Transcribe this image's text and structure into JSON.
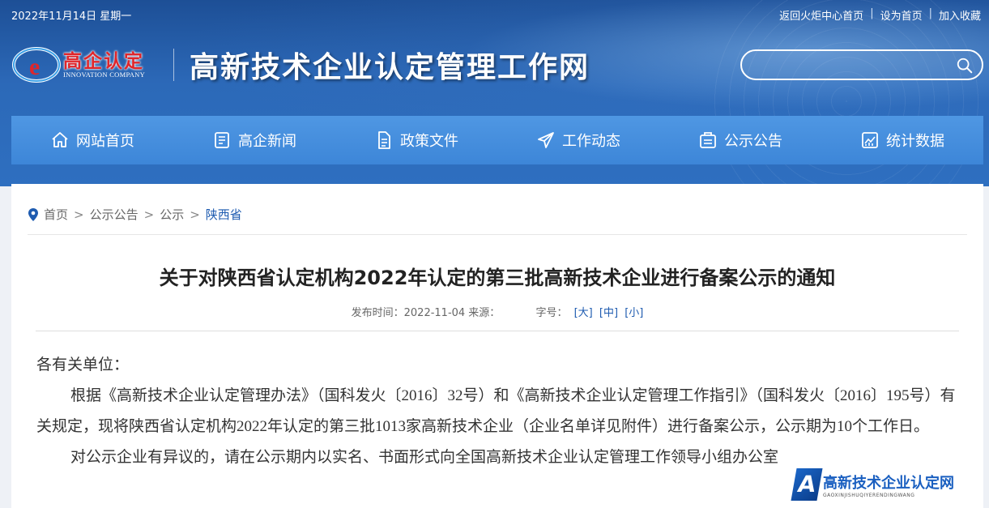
{
  "topbar": {
    "date": "2022年11月14日 星期一",
    "links": [
      "返回火炬中心首页",
      "设为首页",
      "加入收藏"
    ]
  },
  "logo": {
    "name": "高企认定",
    "en": "INNOVATION COMPANY"
  },
  "site_title": "高新技术企业认定管理工作网",
  "search": {
    "placeholder": "",
    "icon": "search-icon"
  },
  "nav": [
    {
      "label": "网站首页",
      "icon": "home-icon"
    },
    {
      "label": "高企新闻",
      "icon": "news-icon"
    },
    {
      "label": "政策文件",
      "icon": "document-icon"
    },
    {
      "label": "工作动态",
      "icon": "send-icon"
    },
    {
      "label": "公示公告",
      "icon": "notice-icon"
    },
    {
      "label": "统计数据",
      "icon": "chart-icon"
    }
  ],
  "breadcrumb": [
    "首页",
    "公示公告",
    "公示",
    "陕西省"
  ],
  "article": {
    "title": "关于对陕西省认定机构2022年认定的第三批高新技术企业进行备案公示的通知",
    "meta_prefix": "发布时间：2022-11-04 来源：",
    "font_label": "字号：",
    "sizes": [
      "[大]",
      "[中]",
      "[小]"
    ],
    "salutation": "各有关单位：",
    "para1": "根据《高新技术企业认定管理办法》（国科发火〔2016〕32号）和《高新技术企业认定管理工作指引》（国科发火〔2016〕195号）有关规定，现将陕西省认定机构2022年认定的第三批1013家高新技术企业（企业名单详见附件）进行备案公示，公示期为10个工作日。",
    "para2": "对公示企业有异议的，请在公示期内以实名、书面形式向全国高新技术企业认定管理工作领导小组办公室"
  },
  "watermark": {
    "title": "高新技术企业认定网",
    "sub": "GAOXINJISHUQIYERENDINGWANG"
  }
}
